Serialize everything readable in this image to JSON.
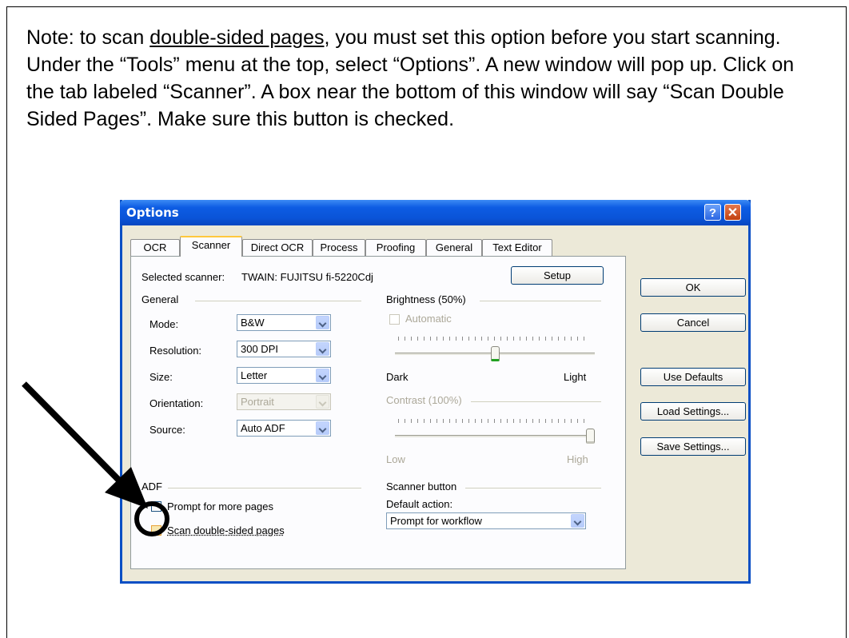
{
  "note": {
    "before": "Note: to scan ",
    "link": "double-sided pages",
    "after": ", you must set this option before you start scanning.  Under the “Tools” menu at the top, select “Options”.   A new window will pop up.  Click on the tab labeled “Scanner”.  A box near the bottom of this window will say “Scan Double Sided Pages”.  Make sure this button is checked."
  },
  "window": {
    "title": "Options",
    "help": "?",
    "close": "✕"
  },
  "tabs": [
    "OCR",
    "Scanner",
    "Direct OCR",
    "Process",
    "Proofing",
    "General",
    "Text Editor"
  ],
  "scanner": {
    "selected_label": "Selected scanner:",
    "selected_value": "TWAIN: FUJITSU fi-5220Cdj",
    "setup_button": "Setup"
  },
  "general": {
    "group": "General",
    "mode_label": "Mode:",
    "mode_value": "B&W",
    "resolution_label": "Resolution:",
    "resolution_value": "300 DPI",
    "size_label": "Size:",
    "size_value": "Letter",
    "orientation_label": "Orientation:",
    "orientation_value": "Portrait",
    "source_label": "Source:",
    "source_value": "Auto ADF"
  },
  "brightness": {
    "group": "Brightness (50%)",
    "automatic": "Automatic",
    "dark": "Dark",
    "light": "Light",
    "level": 0.5
  },
  "contrast": {
    "group": "Contrast (100%)",
    "low": "Low",
    "high": "High",
    "level": 1.0
  },
  "adf": {
    "group": "ADF",
    "prompt_more": "Prompt for more pages",
    "double_sided": "Scan double-sided pages"
  },
  "scanner_button": {
    "group": "Scanner button",
    "default_label": "Default action:",
    "default_value": "Prompt for workflow"
  },
  "side_buttons": {
    "ok": "OK",
    "cancel": "Cancel",
    "use_defaults": "Use Defaults",
    "load": "Load Settings...",
    "save": "Save Settings..."
  }
}
